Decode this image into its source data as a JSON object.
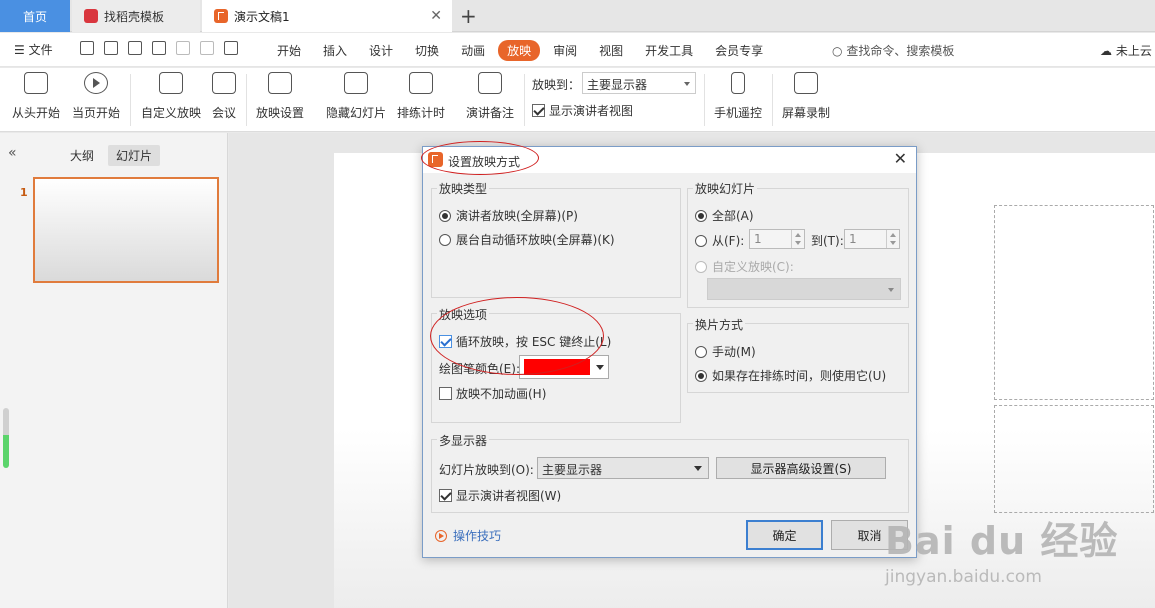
{
  "tabs": {
    "home": "首页",
    "template": "找稻壳模板",
    "document": "演示文稿1"
  },
  "menubar": {
    "file": "文件",
    "items": [
      "开始",
      "插入",
      "设计",
      "切换",
      "动画",
      "放映",
      "审阅",
      "视图",
      "开发工具",
      "会员专享"
    ],
    "active_item": "放映",
    "search": "查找命令、搜索模板",
    "cloud": "未上云"
  },
  "ribbon": {
    "from_start": "从头开始",
    "from_current": "当页开始",
    "custom_show": "自定义放映",
    "meeting": "会议",
    "show_settings": "放映设置",
    "hide_slide": "隐藏幻灯片",
    "rehearse": "排练计时",
    "notes": "演讲备注",
    "output_label": "放映到：",
    "output_value": "主要显示器",
    "presenter_view": "显示演讲者视图",
    "phone_remote": "手机遥控",
    "screen_record": "屏幕录制"
  },
  "left_panel": {
    "outline_tab": "大纲",
    "slides_tab": "幻灯片",
    "slide_number": "1"
  },
  "dialog": {
    "title": "设置放映方式",
    "show_type": {
      "title": "放映类型",
      "presenter": "演讲者放映(全屏幕)(P)",
      "kiosk": "展台自动循环放映(全屏幕)(K)"
    },
    "show_slides": {
      "title": "放映幻灯片",
      "all": "全部(A)",
      "from": "从(F):",
      "from_value": "1",
      "to": "到(T):",
      "to_value": "1",
      "custom": "自定义放映(C):"
    },
    "show_options": {
      "title": "放映选项",
      "loop": "循环放映，按 ESC 键终止(L)",
      "pen_color": "绘图笔颜色(E):",
      "pen_color_value": "#ff0000",
      "no_animation": "放映不加动画(H)"
    },
    "advance": {
      "title": "换片方式",
      "manual": "手动(M)",
      "timings": "如果存在排练时间，则使用它(U)"
    },
    "multi_monitor": {
      "title": "多显示器",
      "show_on": "幻灯片放映到(O):",
      "show_on_value": "主要显示器",
      "advanced_button": "显示器高级设置(S)",
      "presenter_view": "显示演讲者视图(W)"
    },
    "tips": "操作技巧",
    "ok": "确定",
    "cancel": "取消"
  },
  "watermark": {
    "main": "Bai du 经验",
    "sub": "jingyan.baidu.com"
  }
}
